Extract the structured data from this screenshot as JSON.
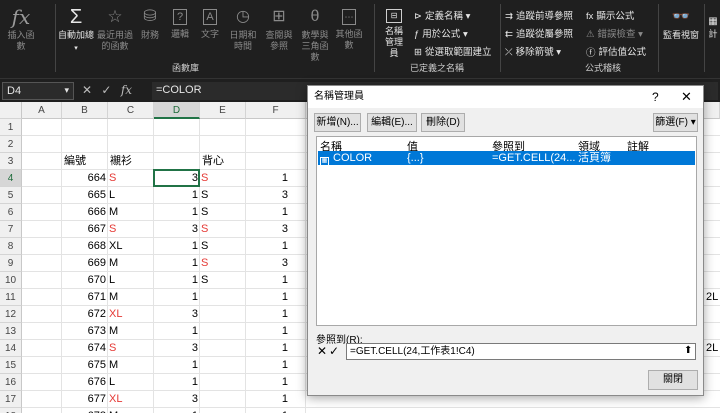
{
  "ribbon": {
    "fx_group": {
      "insert_function": "插入函數",
      "autosum": "自動加總",
      "recent": "最近用過的函數",
      "financial": "財務",
      "logical": "邏輯",
      "text": "文字",
      "datetime": "日期和時間",
      "lookup": "查閱與參照",
      "math": "數學與三角函數",
      "other": "其他函數",
      "group_label": "函數庫"
    },
    "names_group": {
      "name_manager": "名稱管理員",
      "define_name": "定義名稱",
      "use_in_formula": "用於公式",
      "create_from_selection": "從選取範圍建立",
      "group_label": "已定義之名稱"
    },
    "audit_group": {
      "trace_precedents": "追蹤前導參照",
      "trace_dependents": "追蹤從屬參照",
      "remove_arrows": "移除箭號",
      "show_formulas": "顯示公式",
      "error_checking": "錯誤檢查",
      "evaluate_formula": "評估值公式",
      "group_label": "公式稽核"
    },
    "watch_window": "監看視窗",
    "calc_partial": "計"
  },
  "formula_bar": {
    "name_box": "D4",
    "cancel": "✕",
    "confirm": "✓",
    "fx": "fx",
    "formula": "=COLOR"
  },
  "grid": {
    "columns": [
      "A",
      "B",
      "C",
      "D",
      "E",
      "F"
    ],
    "rows": [
      "1",
      "2",
      "3",
      "4",
      "5",
      "6",
      "7",
      "8",
      "9",
      "10",
      "11",
      "12",
      "13",
      "14",
      "15",
      "16",
      "17",
      "18"
    ],
    "header_row": {
      "B": "編號",
      "C": "襯衫",
      "E": "背心"
    },
    "data": [
      {
        "b": "664",
        "c": "S",
        "c_red": true,
        "d": "3",
        "e": "S",
        "f": "1"
      },
      {
        "b": "665",
        "c": "L",
        "c_red": false,
        "d": "1",
        "e": "S",
        "f": "3"
      },
      {
        "b": "666",
        "c": "M",
        "c_red": false,
        "d": "1",
        "e": "S",
        "f": "1"
      },
      {
        "b": "667",
        "c": "S",
        "c_red": true,
        "d": "3",
        "e": "S",
        "f": "3"
      },
      {
        "b": "668",
        "c": "XL",
        "c_red": false,
        "d": "1",
        "e": "S",
        "f": "1"
      },
      {
        "b": "669",
        "c": "M",
        "c_red": false,
        "d": "1",
        "e": "S",
        "f": "3"
      },
      {
        "b": "670",
        "c": "L",
        "c_red": false,
        "d": "1",
        "e": "S",
        "f": "1"
      },
      {
        "b": "671",
        "c": "M",
        "c_red": false,
        "d": "1",
        "e": "",
        "f": "1"
      },
      {
        "b": "672",
        "c": "XL",
        "c_red": true,
        "d": "3",
        "e": "",
        "f": "1"
      },
      {
        "b": "673",
        "c": "M",
        "c_red": false,
        "d": "1",
        "e": "",
        "f": "1"
      },
      {
        "b": "674",
        "c": "S",
        "c_red": true,
        "d": "3",
        "e": "",
        "f": "1"
      },
      {
        "b": "675",
        "c": "M",
        "c_red": false,
        "d": "1",
        "e": "",
        "f": "1"
      },
      {
        "b": "676",
        "c": "L",
        "c_red": false,
        "d": "1",
        "e": "",
        "f": "1"
      },
      {
        "b": "677",
        "c": "XL",
        "c_red": true,
        "d": "3",
        "e": "",
        "f": "1"
      },
      {
        "b": "678",
        "c": "M",
        "c_red": false,
        "d": "1",
        "e": "",
        "f": "1"
      }
    ],
    "right_edge_text": [
      "2L",
      "2L"
    ]
  },
  "dialog": {
    "title": "名稱管理員",
    "help": "?",
    "close": "✕",
    "new_btn": "新增(N)...",
    "edit_btn": "編輯(E)...",
    "delete_btn": "刪除(D)",
    "filter_btn": "篩選(F)",
    "columns": [
      "名稱",
      "值",
      "參照到",
      "領域",
      "註解"
    ],
    "rows": [
      {
        "name": "COLOR",
        "value": "{...}",
        "refers_to": "=GET.CELL(24...",
        "scope": "活頁簿",
        "comment": ""
      }
    ],
    "refers_label": "參照到(R):",
    "refers_value": "=GET.CELL(24,工作表1!C4)",
    "close_btn": "關閉"
  },
  "colors": {
    "ribbon_bg": "#1f1f1f",
    "selection_blue": "#0078d7",
    "accent_green": "#217346",
    "red_text": "#e53935"
  }
}
